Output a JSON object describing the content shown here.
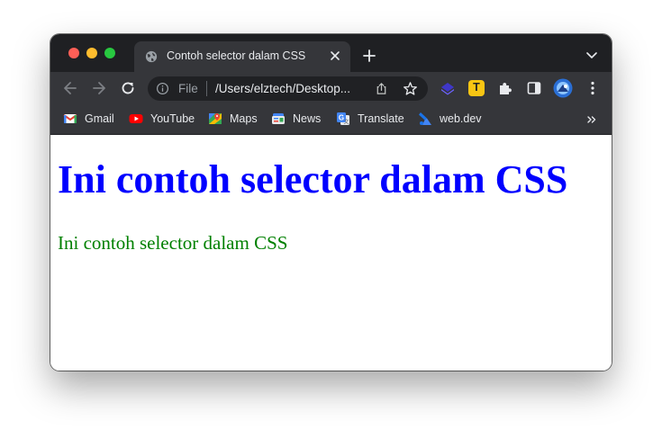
{
  "browser": {
    "tab": {
      "title": "Contoh selector dalam CSS",
      "favicon_icon": "globe-icon",
      "close_icon": "close-icon"
    },
    "new_tab_icon": "plus-icon",
    "tab_search_icon": "chevron-down-icon",
    "toolbar": {
      "back_icon": "arrow-left-icon",
      "forward_icon": "arrow-right-icon",
      "reload_icon": "reload-icon",
      "omnibox": {
        "info_icon": "info-icon",
        "scheme": "File",
        "url": "/Users/elztech/Desktop...",
        "share_icon": "share-icon",
        "bookmark_icon": "star-icon"
      },
      "extensions": [
        {
          "name": "layers-extension-icon"
        },
        {
          "name": "t-extension-icon",
          "letter": "T"
        },
        {
          "name": "puzzle-icon"
        },
        {
          "name": "side-panel-icon"
        },
        {
          "name": "profile-avatar"
        }
      ],
      "menu_icon": "more-vert-icon"
    },
    "bookmarks": [
      {
        "label": "Gmail",
        "icon": "gmail-icon"
      },
      {
        "label": "YouTube",
        "icon": "youtube-icon"
      },
      {
        "label": "Maps",
        "icon": "maps-icon"
      },
      {
        "label": "News",
        "icon": "news-icon"
      },
      {
        "label": "Translate",
        "icon": "translate-icon"
      },
      {
        "label": "web.dev",
        "icon": "webdev-icon"
      }
    ],
    "bookmarks_overflow_icon": "double-chevron-icon"
  },
  "page": {
    "heading": "Ini contoh selector dalam CSS",
    "paragraph": "Ini contoh selector dalam CSS"
  },
  "colors": {
    "heading": "#0000ff",
    "paragraph": "#008000",
    "tabstrip": "#1f2023",
    "toolbar": "#35363a"
  }
}
